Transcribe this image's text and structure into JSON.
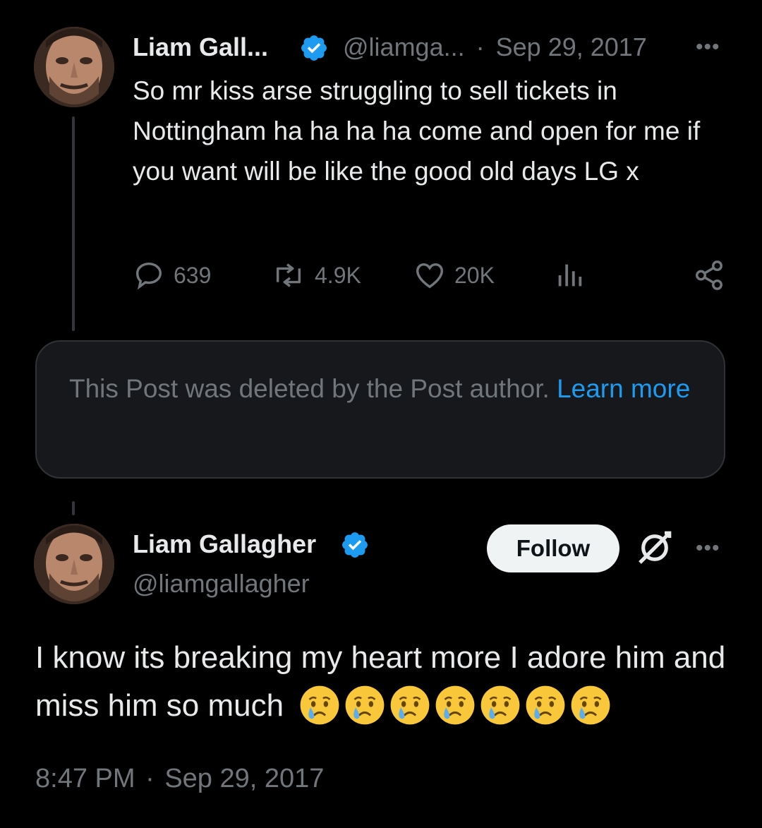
{
  "colors": {
    "background": "#000000",
    "text": "#e7e9ea",
    "muted": "#71767b",
    "accent": "#1d9bf0",
    "card": "#16181c",
    "follow_bg": "#eff3f4"
  },
  "parent_post": {
    "display_name": "Liam Gall...",
    "handle": "@liamga...",
    "separator": "·",
    "date": "Sep 29, 2017",
    "text": "So mr kiss arse struggling to sell tickets in Nottingham ha ha ha ha come and open for me if you want will be like the good old days LG x",
    "verified_icon": "verified-badge-icon",
    "actions": {
      "replies": "639",
      "reposts": "4.9K",
      "likes": "20K"
    }
  },
  "deleted_notice": {
    "text": "This Post was deleted by the Post author.",
    "link": "Learn more"
  },
  "main_post": {
    "display_name": "Liam Gallagher",
    "handle": "@liamgallagher",
    "follow_label": "Follow",
    "text": "I know its breaking my heart more I adore him and miss him so much",
    "emoji_icon": "crying-face-icon",
    "emoji_count": 7,
    "time": "8:47 PM",
    "separator": "·",
    "date": "Sep 29, 2017"
  }
}
